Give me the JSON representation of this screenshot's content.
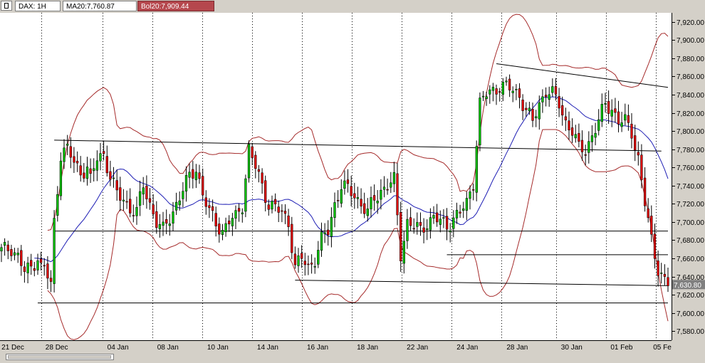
{
  "toolbar": {
    "symbol_label": "DAX: 1H",
    "ma_label": "MA20:7,760.87",
    "bol_label": "Bol20:7,909.44"
  },
  "colors": {
    "up_candle": "#00c000",
    "down_candle": "#e00000",
    "ma_line": "#1f1fb5",
    "bollinger": "#a52a2a",
    "trendline": "#000000",
    "price_badge": "#808080"
  },
  "chart_data": {
    "type": "candlestick",
    "timeframe": "1H",
    "ylim": [
      7570,
      7930
    ],
    "y_ticks": [
      "7,580.00",
      "7,600.00",
      "7,620.00",
      "7,640.00",
      "7,660.00",
      "7,680.00",
      "7,700.00",
      "7,720.00",
      "7,740.00",
      "7,760.00",
      "7,780.00",
      "7,800.00",
      "7,820.00",
      "7,840.00",
      "7,860.00",
      "7,880.00",
      "7,900.00",
      "7,920.00"
    ],
    "x_ticks": [
      "21 Dec",
      "28 Dec",
      "04 Jan",
      "08 Jan",
      "10 Jan",
      "14 Jan",
      "16 Jan",
      "18 Jan",
      "22 Jan",
      "24 Jan",
      "28 Jan",
      "30 Jan",
      "01 Feb",
      "05 Fe"
    ],
    "last_price_label": "7,630.80",
    "last_price": 7630.8,
    "close_path": [
      [
        0,
        7668
      ],
      [
        3,
        7672
      ],
      [
        5,
        7662
      ],
      [
        7,
        7645
      ],
      [
        9,
        7650
      ],
      [
        11,
        7662
      ],
      [
        12,
        7650
      ],
      [
        13,
        7650
      ],
      [
        14,
        7640
      ],
      [
        15,
        7630
      ],
      [
        16,
        7700
      ],
      [
        18,
        7775
      ],
      [
        20,
        7780
      ],
      [
        22,
        7765
      ],
      [
        24,
        7755
      ],
      [
        26,
        7760
      ],
      [
        27,
        7745
      ],
      [
        29,
        7770
      ],
      [
        31,
        7775
      ],
      [
        33,
        7750
      ],
      [
        35,
        7730
      ],
      [
        37,
        7725
      ],
      [
        39,
        7715
      ],
      [
        41,
        7710
      ],
      [
        43,
        7740
      ],
      [
        45,
        7720
      ],
      [
        47,
        7700
      ],
      [
        49,
        7690
      ],
      [
        51,
        7705
      ],
      [
        53,
        7720
      ],
      [
        55,
        7735
      ],
      [
        57,
        7750
      ],
      [
        59,
        7760
      ],
      [
        61,
        7730
      ],
      [
        63,
        7710
      ],
      [
        65,
        7700
      ],
      [
        67,
        7690
      ],
      [
        69,
        7700
      ],
      [
        71,
        7705
      ],
      [
        73,
        7720
      ],
      [
        75,
        7780
      ],
      [
        77,
        7760
      ],
      [
        79,
        7740
      ],
      [
        81,
        7720
      ],
      [
        83,
        7715
      ],
      [
        85,
        7710
      ],
      [
        87,
        7700
      ],
      [
        89,
        7650
      ],
      [
        91,
        7660
      ],
      [
        93,
        7650
      ],
      [
        95,
        7660
      ],
      [
        97,
        7680
      ],
      [
        99,
        7690
      ],
      [
        101,
        7720
      ],
      [
        103,
        7740
      ],
      [
        105,
        7735
      ],
      [
        107,
        7730
      ],
      [
        109,
        7720
      ],
      [
        111,
        7710
      ],
      [
        113,
        7725
      ],
      [
        115,
        7735
      ],
      [
        117,
        7740
      ],
      [
        119,
        7745
      ],
      [
        121,
        7665
      ],
      [
        123,
        7700
      ],
      [
        125,
        7695
      ],
      [
        127,
        7690
      ],
      [
        129,
        7700
      ],
      [
        131,
        7705
      ],
      [
        133,
        7700
      ],
      [
        135,
        7695
      ],
      [
        137,
        7705
      ],
      [
        139,
        7710
      ],
      [
        141,
        7720
      ],
      [
        143,
        7745
      ],
      [
        145,
        7830
      ],
      [
        147,
        7840
      ],
      [
        149,
        7845
      ],
      [
        151,
        7850
      ],
      [
        153,
        7848
      ],
      [
        155,
        7845
      ],
      [
        157,
        7840
      ],
      [
        159,
        7822
      ],
      [
        161,
        7810
      ],
      [
        163,
        7830
      ],
      [
        165,
        7845
      ],
      [
        167,
        7840
      ],
      [
        169,
        7830
      ],
      [
        171,
        7810
      ],
      [
        173,
        7800
      ],
      [
        175,
        7780
      ],
      [
        177,
        7780
      ],
      [
        179,
        7795
      ],
      [
        181,
        7810
      ],
      [
        183,
        7830
      ],
      [
        185,
        7825
      ],
      [
        187,
        7810
      ],
      [
        189,
        7810
      ],
      [
        191,
        7800
      ],
      [
        193,
        7770
      ],
      [
        195,
        7720
      ],
      [
        197,
        7680
      ],
      [
        199,
        7650
      ],
      [
        201,
        7635
      ],
      [
        202,
        7631
      ]
    ],
    "annotations": "trendlines and horizontal support levels"
  }
}
